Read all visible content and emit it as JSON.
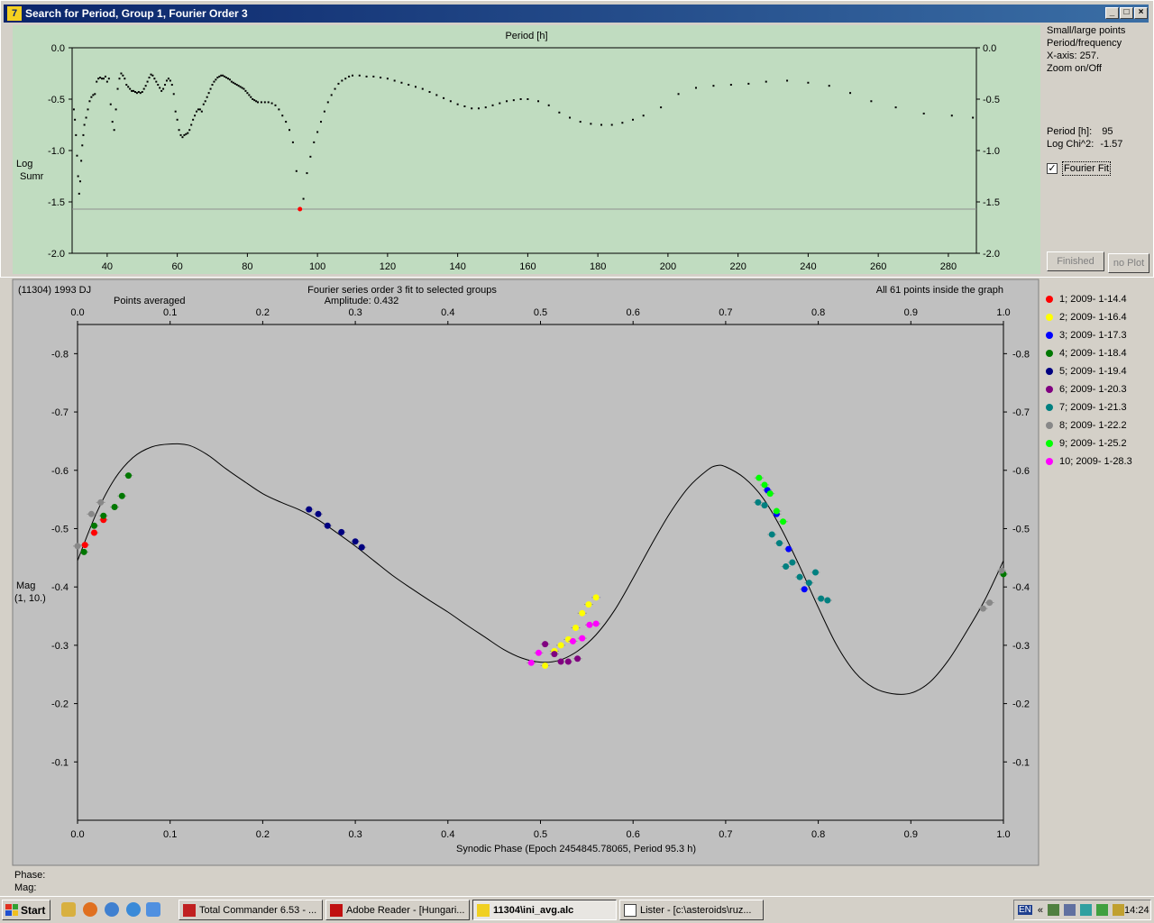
{
  "window": {
    "title": "Search for Period, Group 1, Fourier Order 3",
    "app_icon": "7",
    "minimize": "_",
    "maximize": "□",
    "close": "×"
  },
  "periodogram": {
    "top_label": "Period [h]",
    "y_label_line1": "Log",
    "y_label_line2": "Sumr",
    "x_ticks": [
      "40",
      "60",
      "80",
      "100",
      "120",
      "140",
      "160",
      "180",
      "200",
      "220",
      "240",
      "260",
      "280"
    ],
    "y_ticks": [
      "0.0",
      "-0.5",
      "-1.0",
      "-1.5",
      "-2.0"
    ],
    "x_range": [
      30,
      288
    ],
    "y_range": [
      0,
      -2
    ],
    "threshold": -1.57,
    "best": {
      "period": 95,
      "value": -1.57
    },
    "points": [
      [
        30.5,
        -0.6
      ],
      [
        30.8,
        -0.7
      ],
      [
        31.1,
        -0.85
      ],
      [
        31.4,
        -1.05
      ],
      [
        31.7,
        -1.25
      ],
      [
        32,
        -1.42
      ],
      [
        32.3,
        -1.3
      ],
      [
        32.6,
        -1.1
      ],
      [
        32.9,
        -0.95
      ],
      [
        33.2,
        -0.85
      ],
      [
        33.5,
        -0.75
      ],
      [
        34,
        -0.68
      ],
      [
        34.5,
        -0.6
      ],
      [
        35,
        -0.52
      ],
      [
        35.5,
        -0.48
      ],
      [
        36,
        -0.46
      ],
      [
        36.5,
        -0.45
      ],
      [
        37,
        -0.33
      ],
      [
        37.5,
        -0.3
      ],
      [
        38,
        -0.29
      ],
      [
        38.5,
        -0.3
      ],
      [
        39,
        -0.3
      ],
      [
        39.5,
        -0.28
      ],
      [
        40,
        -0.33
      ],
      [
        40.5,
        -0.3
      ],
      [
        41,
        -0.55
      ],
      [
        41.5,
        -0.72
      ],
      [
        42,
        -0.8
      ],
      [
        42.5,
        -0.6
      ],
      [
        43,
        -0.4
      ],
      [
        43.5,
        -0.3
      ],
      [
        44,
        -0.25
      ],
      [
        44.5,
        -0.27
      ],
      [
        45,
        -0.3
      ],
      [
        45.5,
        -0.36
      ],
      [
        46,
        -0.38
      ],
      [
        46.5,
        -0.4
      ],
      [
        47,
        -0.42
      ],
      [
        47.5,
        -0.42
      ],
      [
        48,
        -0.43
      ],
      [
        48.5,
        -0.44
      ],
      [
        49,
        -0.43
      ],
      [
        49.5,
        -0.44
      ],
      [
        50,
        -0.43
      ],
      [
        50.5,
        -0.4
      ],
      [
        51,
        -0.37
      ],
      [
        51.5,
        -0.33
      ],
      [
        52,
        -0.29
      ],
      [
        52.5,
        -0.26
      ],
      [
        53,
        -0.27
      ],
      [
        53.5,
        -0.3
      ],
      [
        54,
        -0.33
      ],
      [
        54.5,
        -0.36
      ],
      [
        55,
        -0.39
      ],
      [
        55.5,
        -0.42
      ],
      [
        56,
        -0.4
      ],
      [
        56.5,
        -0.36
      ],
      [
        57,
        -0.32
      ],
      [
        57.5,
        -0.3
      ],
      [
        58,
        -0.32
      ],
      [
        58.5,
        -0.36
      ],
      [
        59,
        -0.45
      ],
      [
        59.5,
        -0.62
      ],
      [
        60,
        -0.7
      ],
      [
        60.5,
        -0.8
      ],
      [
        61,
        -0.85
      ],
      [
        61.5,
        -0.87
      ],
      [
        62,
        -0.85
      ],
      [
        62.5,
        -0.84
      ],
      [
        63,
        -0.83
      ],
      [
        63.5,
        -0.8
      ],
      [
        64,
        -0.75
      ],
      [
        64.5,
        -0.7
      ],
      [
        65,
        -0.66
      ],
      [
        65.5,
        -0.62
      ],
      [
        66,
        -0.6
      ],
      [
        66.5,
        -0.6
      ],
      [
        67,
        -0.62
      ],
      [
        67.5,
        -0.55
      ],
      [
        68,
        -0.52
      ],
      [
        68.5,
        -0.48
      ],
      [
        69,
        -0.44
      ],
      [
        69.5,
        -0.4
      ],
      [
        70,
        -0.36
      ],
      [
        70.5,
        -0.33
      ],
      [
        71,
        -0.31
      ],
      [
        71.5,
        -0.29
      ],
      [
        72,
        -0.28
      ],
      [
        72.5,
        -0.27
      ],
      [
        73,
        -0.27
      ],
      [
        73.5,
        -0.28
      ],
      [
        74,
        -0.29
      ],
      [
        74.5,
        -0.3
      ],
      [
        75,
        -0.31
      ],
      [
        75.5,
        -0.33
      ],
      [
        76,
        -0.34
      ],
      [
        76.5,
        -0.35
      ],
      [
        77,
        -0.36
      ],
      [
        77.5,
        -0.37
      ],
      [
        78,
        -0.38
      ],
      [
        78.5,
        -0.39
      ],
      [
        79,
        -0.4
      ],
      [
        79.5,
        -0.42
      ],
      [
        80,
        -0.44
      ],
      [
        80.5,
        -0.46
      ],
      [
        81,
        -0.48
      ],
      [
        81.5,
        -0.5
      ],
      [
        82,
        -0.51
      ],
      [
        82.5,
        -0.52
      ],
      [
        83,
        -0.53
      ],
      [
        84,
        -0.53
      ],
      [
        85,
        -0.53
      ],
      [
        86,
        -0.53
      ],
      [
        87,
        -0.54
      ],
      [
        88,
        -0.56
      ],
      [
        89,
        -0.6
      ],
      [
        90,
        -0.66
      ],
      [
        91,
        -0.72
      ],
      [
        92,
        -0.8
      ],
      [
        93,
        -0.92
      ],
      [
        94,
        -1.2
      ],
      [
        95,
        -1.57
      ],
      [
        96,
        -1.47
      ],
      [
        97,
        -1.22
      ],
      [
        98,
        -1.06
      ],
      [
        99,
        -0.92
      ],
      [
        100,
        -0.82
      ],
      [
        101,
        -0.72
      ],
      [
        102,
        -0.62
      ],
      [
        103,
        -0.53
      ],
      [
        104,
        -0.46
      ],
      [
        105,
        -0.4
      ],
      [
        106,
        -0.35
      ],
      [
        107,
        -0.32
      ],
      [
        108,
        -0.3
      ],
      [
        109,
        -0.28
      ],
      [
        110,
        -0.27
      ],
      [
        112,
        -0.27
      ],
      [
        114,
        -0.28
      ],
      [
        116,
        -0.28
      ],
      [
        118,
        -0.29
      ],
      [
        120,
        -0.3
      ],
      [
        122,
        -0.32
      ],
      [
        124,
        -0.34
      ],
      [
        126,
        -0.36
      ],
      [
        128,
        -0.38
      ],
      [
        130,
        -0.4
      ],
      [
        132,
        -0.43
      ],
      [
        134,
        -0.46
      ],
      [
        136,
        -0.49
      ],
      [
        138,
        -0.52
      ],
      [
        140,
        -0.55
      ],
      [
        142,
        -0.57
      ],
      [
        144,
        -0.59
      ],
      [
        146,
        -0.59
      ],
      [
        148,
        -0.58
      ],
      [
        150,
        -0.56
      ],
      [
        152,
        -0.54
      ],
      [
        154,
        -0.52
      ],
      [
        156,
        -0.51
      ],
      [
        158,
        -0.5
      ],
      [
        160,
        -0.5
      ],
      [
        163,
        -0.52
      ],
      [
        166,
        -0.56
      ],
      [
        169,
        -0.63
      ],
      [
        172,
        -0.68
      ],
      [
        175,
        -0.72
      ],
      [
        178,
        -0.74
      ],
      [
        181,
        -0.75
      ],
      [
        184,
        -0.75
      ],
      [
        187,
        -0.73
      ],
      [
        190,
        -0.7
      ],
      [
        193,
        -0.66
      ],
      [
        198,
        -0.58
      ],
      [
        203,
        -0.45
      ],
      [
        208,
        -0.39
      ],
      [
        213,
        -0.37
      ],
      [
        218,
        -0.36
      ],
      [
        223,
        -0.35
      ],
      [
        228,
        -0.33
      ],
      [
        234,
        -0.32
      ],
      [
        240,
        -0.34
      ],
      [
        246,
        -0.37
      ],
      [
        252,
        -0.44
      ],
      [
        258,
        -0.52
      ],
      [
        265,
        -0.58
      ],
      [
        273,
        -0.64
      ],
      [
        281,
        -0.66
      ],
      [
        287,
        -0.68
      ]
    ]
  },
  "right_panel": {
    "line1": "Small/large points",
    "line2": "Period/frequency",
    "line3": "X-axis: 257.",
    "line4": "Zoom on/Off",
    "period_label": "Period [h]:",
    "period_value": "95",
    "chi_label": "Log Chi^2:",
    "chi_value": "-1.57",
    "fourier_fit_label": "Fourier Fit",
    "fourier_fit_checked": true,
    "finished_button": "Finished",
    "noplot_button": "no Plot"
  },
  "chart_data": {
    "type": "scatter",
    "object_name": "(11304) 1993 DJ",
    "points_averaged": "Points averaged",
    "title": "Fourier series order 3 fit to selected groups",
    "amplitude": "Amplitude: 0.432",
    "inside_label": "All 61 points inside the graph",
    "xlabel": "Synodic Phase (Epoch 2454845.78065, Period 95.3 h)",
    "ylabel_line1": "Mag",
    "ylabel_line2": "(1, 10.)",
    "xlim": [
      0,
      1
    ],
    "ylim": [
      -0.85,
      0.0
    ],
    "x_ticks": [
      "0.0",
      "0.1",
      "0.2",
      "0.3",
      "0.4",
      "0.5",
      "0.6",
      "0.7",
      "0.8",
      "0.9",
      "1.0"
    ],
    "y_ticks": [
      "-0.1",
      "-0.2",
      "-0.3",
      "-0.4",
      "-0.5",
      "-0.6",
      "-0.7",
      "-0.8"
    ],
    "curve": [
      [
        0.0,
        -0.445
      ],
      [
        0.02,
        -0.525
      ],
      [
        0.04,
        -0.585
      ],
      [
        0.06,
        -0.622
      ],
      [
        0.08,
        -0.64
      ],
      [
        0.1,
        -0.645
      ],
      [
        0.12,
        -0.643
      ],
      [
        0.14,
        -0.627
      ],
      [
        0.16,
        -0.603
      ],
      [
        0.18,
        -0.581
      ],
      [
        0.2,
        -0.56
      ],
      [
        0.22,
        -0.545
      ],
      [
        0.24,
        -0.532
      ],
      [
        0.26,
        -0.515
      ],
      [
        0.28,
        -0.493
      ],
      [
        0.3,
        -0.47
      ],
      [
        0.32,
        -0.445
      ],
      [
        0.34,
        -0.42
      ],
      [
        0.36,
        -0.398
      ],
      [
        0.38,
        -0.377
      ],
      [
        0.4,
        -0.357
      ],
      [
        0.42,
        -0.335
      ],
      [
        0.44,
        -0.314
      ],
      [
        0.46,
        -0.293
      ],
      [
        0.48,
        -0.278
      ],
      [
        0.5,
        -0.271
      ],
      [
        0.52,
        -0.274
      ],
      [
        0.54,
        -0.29
      ],
      [
        0.56,
        -0.318
      ],
      [
        0.58,
        -0.36
      ],
      [
        0.6,
        -0.415
      ],
      [
        0.62,
        -0.473
      ],
      [
        0.64,
        -0.527
      ],
      [
        0.66,
        -0.571
      ],
      [
        0.68,
        -0.6
      ],
      [
        0.69,
        -0.608
      ],
      [
        0.7,
        -0.606
      ],
      [
        0.72,
        -0.587
      ],
      [
        0.74,
        -0.553
      ],
      [
        0.76,
        -0.5
      ],
      [
        0.78,
        -0.435
      ],
      [
        0.8,
        -0.365
      ],
      [
        0.82,
        -0.3
      ],
      [
        0.84,
        -0.253
      ],
      [
        0.86,
        -0.227
      ],
      [
        0.88,
        -0.217
      ],
      [
        0.9,
        -0.218
      ],
      [
        0.92,
        -0.236
      ],
      [
        0.94,
        -0.273
      ],
      [
        0.96,
        -0.323
      ],
      [
        0.98,
        -0.378
      ],
      [
        1.0,
        -0.445
      ]
    ],
    "series": [
      {
        "name": "1; 2009- 1-14.4",
        "color": "#ff0000",
        "points": [
          [
            0.008,
            -0.472
          ],
          [
            0.018,
            -0.493
          ],
          [
            0.028,
            -0.515
          ]
        ]
      },
      {
        "name": "2; 2009- 1-16.4",
        "color": "#ffff00",
        "points": [
          [
            0.505,
            -0.265
          ],
          [
            0.515,
            -0.29
          ],
          [
            0.522,
            -0.3
          ],
          [
            0.53,
            -0.31
          ],
          [
            0.538,
            -0.33
          ],
          [
            0.545,
            -0.355
          ],
          [
            0.552,
            -0.37
          ],
          [
            0.56,
            -0.382
          ]
        ]
      },
      {
        "name": "3; 2009- 1-17.3",
        "color": "#0000ff",
        "points": [
          [
            0.745,
            -0.566
          ],
          [
            0.755,
            -0.525
          ],
          [
            0.768,
            -0.465
          ],
          [
            0.785,
            -0.396
          ]
        ]
      },
      {
        "name": "4; 2009- 1-18.4",
        "color": "#007700",
        "points": [
          [
            0.007,
            -0.46
          ],
          [
            0.018,
            -0.505
          ],
          [
            0.028,
            -0.522
          ],
          [
            0.04,
            -0.537
          ],
          [
            0.048,
            -0.556
          ],
          [
            0.055,
            -0.591
          ],
          [
            1.0,
            -0.422
          ]
        ]
      },
      {
        "name": "5; 2009- 1-19.4",
        "color": "#000080",
        "points": [
          [
            0.25,
            -0.533
          ],
          [
            0.26,
            -0.525
          ],
          [
            0.27,
            -0.505
          ],
          [
            0.285,
            -0.494
          ],
          [
            0.3,
            -0.478
          ],
          [
            0.307,
            -0.468
          ]
        ]
      },
      {
        "name": "6; 2009- 1-20.3",
        "color": "#800080",
        "points": [
          [
            0.505,
            -0.302
          ],
          [
            0.515,
            -0.285
          ],
          [
            0.522,
            -0.272
          ],
          [
            0.53,
            -0.272
          ],
          [
            0.54,
            -0.277
          ]
        ]
      },
      {
        "name": "7; 2009- 1-21.3",
        "color": "#008080",
        "points": [
          [
            0.735,
            -0.545
          ],
          [
            0.742,
            -0.54
          ],
          [
            0.75,
            -0.49
          ],
          [
            0.758,
            -0.475
          ],
          [
            0.765,
            -0.435
          ],
          [
            0.772,
            -0.442
          ],
          [
            0.78,
            -0.417
          ],
          [
            0.79,
            -0.407
          ],
          [
            0.797,
            -0.425
          ],
          [
            0.803,
            -0.38
          ],
          [
            0.81,
            -0.377
          ]
        ]
      },
      {
        "name": "8; 2009- 1-22.2",
        "color": "#888888",
        "points": [
          [
            0.0,
            -0.47
          ],
          [
            0.015,
            -0.525
          ],
          [
            0.025,
            -0.545
          ],
          [
            0.978,
            -0.363
          ],
          [
            0.985,
            -0.373
          ],
          [
            0.998,
            -0.428
          ]
        ]
      },
      {
        "name": "9; 2009- 1-25.2",
        "color": "#00ff00",
        "points": [
          [
            0.736,
            -0.587
          ],
          [
            0.742,
            -0.575
          ],
          [
            0.748,
            -0.56
          ],
          [
            0.755,
            -0.53
          ],
          [
            0.762,
            -0.512
          ]
        ]
      },
      {
        "name": "10; 2009- 1-28.3",
        "color": "#ff00ff",
        "points": [
          [
            0.49,
            -0.27
          ],
          [
            0.498,
            -0.287
          ],
          [
            0.535,
            -0.307
          ],
          [
            0.545,
            -0.312
          ],
          [
            0.553,
            -0.335
          ],
          [
            0.56,
            -0.337
          ]
        ]
      }
    ]
  },
  "readout": {
    "phase_label": "Phase:",
    "mag_label": "Mag:"
  },
  "taskbar": {
    "start": "Start",
    "tasks": [
      {
        "label": "Total Commander 6.53 - ..."
      },
      {
        "label": "Adobe Reader - [Hungari..."
      },
      {
        "label": "11304\\ini_avg.alc"
      },
      {
        "label": "Lister - [c:\\asteroids\\ruz..."
      }
    ],
    "lang": "EN",
    "chevron": "«",
    "clock": "14:24"
  }
}
